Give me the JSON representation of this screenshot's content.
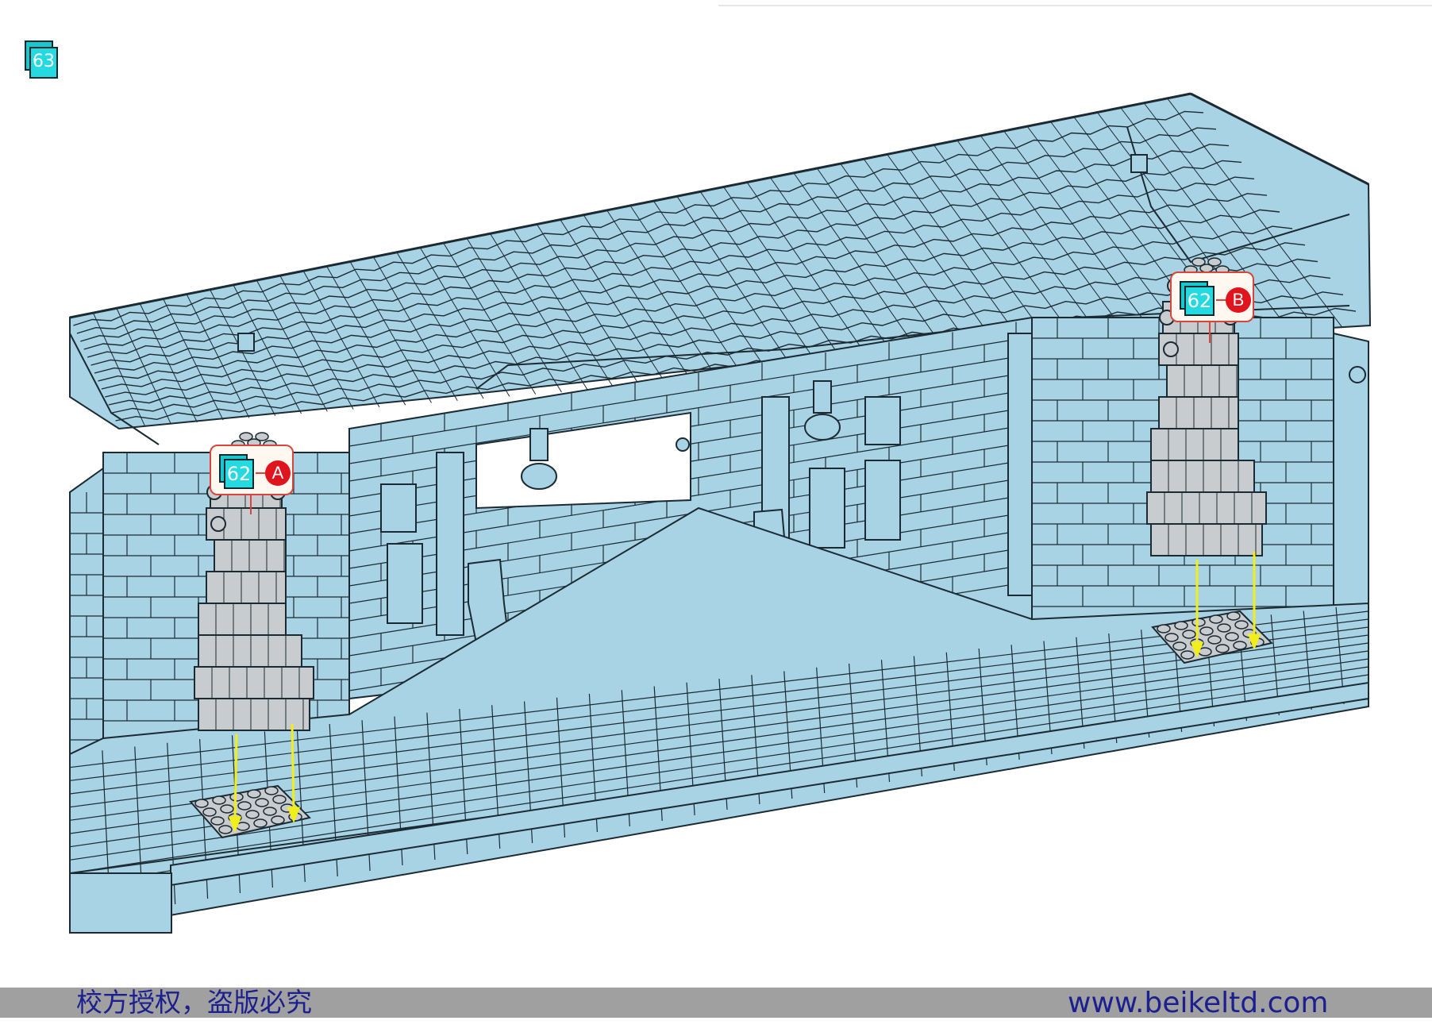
{
  "step_number": "63",
  "callouts": [
    {
      "step": "62",
      "letter": "A"
    },
    {
      "step": "62",
      "letter": "B"
    }
  ],
  "footer": {
    "notice": "校方授权，盗版必究",
    "website": "www.beikeltd.com"
  },
  "colors": {
    "model_fill": "#a7d3e4",
    "outline": "#1c2a33",
    "statue_gray": "#c8ccce",
    "arrow_yellow": "#f2ee1a",
    "badge_cyan": "#24d9e0",
    "callout_red": "#e0141c",
    "footer_bar": "#a0a0a0",
    "footer_text": "#1b1f8f"
  }
}
